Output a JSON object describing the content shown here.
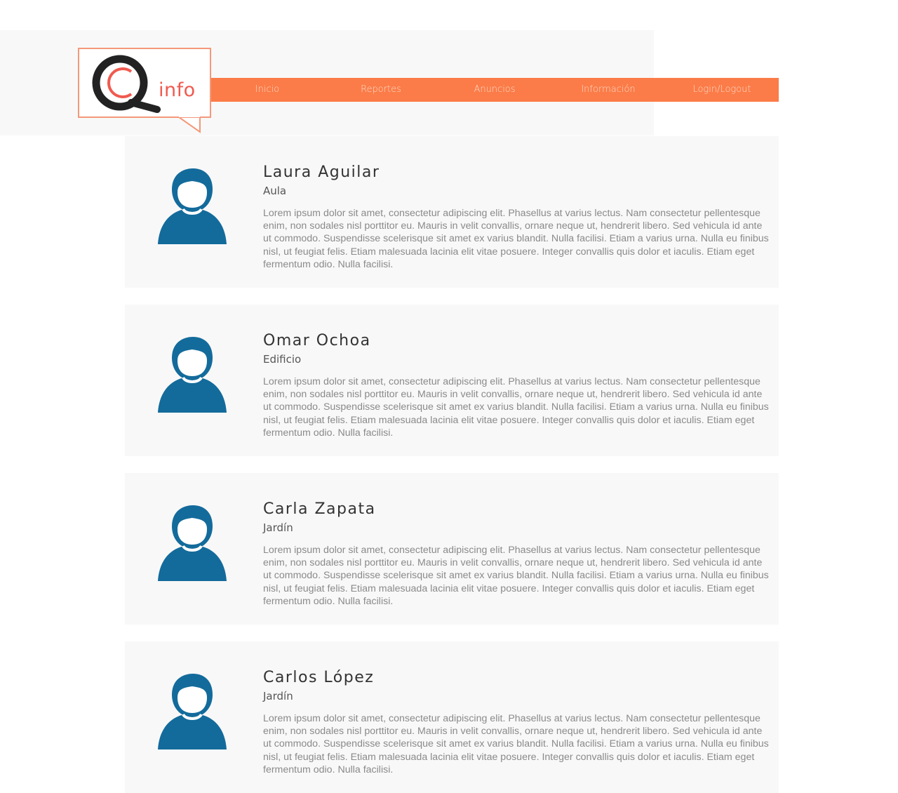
{
  "brand": {
    "logo_text": "info",
    "logo_letter": "Q",
    "accent_color": "#fb7c48",
    "logo_color": "#f05a4f"
  },
  "nav": {
    "items": [
      {
        "label": "Inicio"
      },
      {
        "label": "Reportes"
      },
      {
        "label": "Anuncios"
      },
      {
        "label": "Información"
      },
      {
        "label": "Login/Logout"
      }
    ]
  },
  "cards": [
    {
      "name": "Laura Aguilar",
      "location": "Aula",
      "description": "Lorem ipsum dolor sit amet, consectetur adipiscing elit. Phasellus at varius lectus. Nam consectetur pellentesque enim, non sodales nisl porttitor eu. Mauris in velit convallis, ornare neque ut, hendrerit libero. Sed vehicula id ante ut commodo. Suspendisse scelerisque sit amet ex varius blandit. Nulla facilisi. Etiam a varius urna. Nulla eu finibus nisl, ut feugiat felis. Etiam malesuada lacinia elit vitae posuere. Integer convallis quis dolor et iaculis. Etiam eget fermentum odio. Nulla facilisi.",
      "avatar_icon": "user-avatar-icon"
    },
    {
      "name": "Omar Ochoa",
      "location": "Edificio",
      "description": "Lorem ipsum dolor sit amet, consectetur adipiscing elit. Phasellus at varius lectus. Nam consectetur pellentesque enim, non sodales nisl porttitor eu. Mauris in velit convallis, ornare neque ut, hendrerit libero. Sed vehicula id ante ut commodo. Suspendisse scelerisque sit amet ex varius blandit. Nulla facilisi. Etiam a varius urna. Nulla eu finibus nisl, ut feugiat felis. Etiam malesuada lacinia elit vitae posuere. Integer convallis quis dolor et iaculis. Etiam eget fermentum odio. Nulla facilisi.",
      "avatar_icon": "user-avatar-icon"
    },
    {
      "name": "Carla Zapata",
      "location": "Jardín",
      "description": "Lorem ipsum dolor sit amet, consectetur adipiscing elit. Phasellus at varius lectus. Nam consectetur pellentesque enim, non sodales nisl porttitor eu. Mauris in velit convallis, ornare neque ut, hendrerit libero. Sed vehicula id ante ut commodo. Suspendisse scelerisque sit amet ex varius blandit. Nulla facilisi. Etiam a varius urna. Nulla eu finibus nisl, ut feugiat felis. Etiam malesuada lacinia elit vitae posuere. Integer convallis quis dolor et iaculis. Etiam eget fermentum odio. Nulla facilisi.",
      "avatar_icon": "user-avatar-icon"
    },
    {
      "name": "Carlos López",
      "location": "Jardín",
      "description": "Lorem ipsum dolor sit amet, consectetur adipiscing elit. Phasellus at varius lectus. Nam consectetur pellentesque enim, non sodales nisl porttitor eu. Mauris in velit convallis, ornare neque ut, hendrerit libero. Sed vehicula id ante ut commodo. Suspendisse scelerisque sit amet ex varius blandit. Nulla facilisi. Etiam a varius urna. Nulla eu finibus nisl, ut feugiat felis. Etiam malesuada lacinia elit vitae posuere. Integer convallis quis dolor et iaculis. Etiam eget fermentum odio. Nulla facilisi.",
      "avatar_icon": "user-avatar-icon"
    }
  ],
  "colors": {
    "avatar": "#136b9b",
    "panel_bg": "#f8f8f8",
    "logo_border": "#f4987a"
  }
}
